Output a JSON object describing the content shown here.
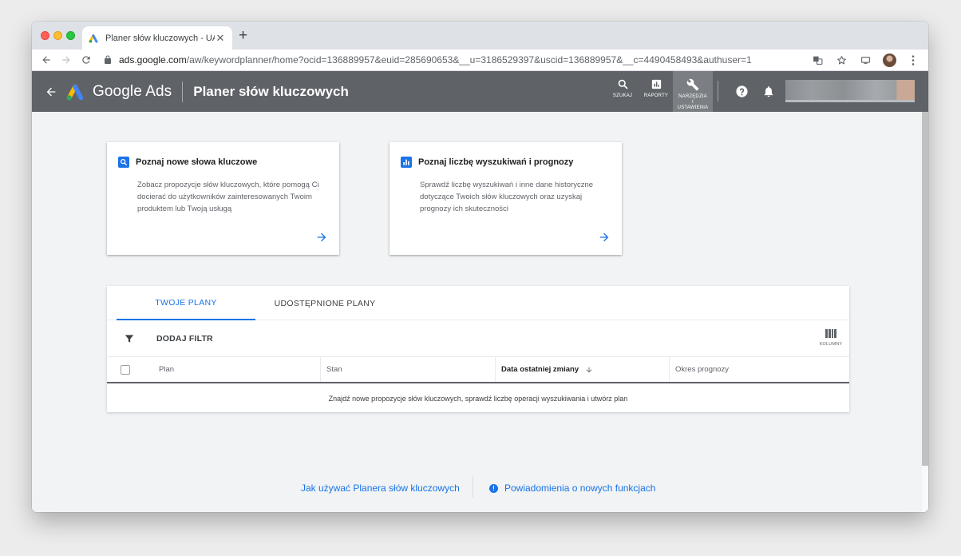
{
  "browser": {
    "tab_title": "Planer słów kluczowych - UAB \"",
    "tab_close": "✕",
    "new_tab": "+",
    "url_host": "ads.google.com",
    "url_path": "/aw/keywordplanner/home?ocid=136889957&euid=285690653&__u=3186529397&uscid=136889957&__c=4490458493&authuser=1"
  },
  "ads_header": {
    "brand": "Google Ads",
    "page_title": "Planer słów kluczowych",
    "actions": [
      {
        "label": "SZUKAJ",
        "icon": "search-icon"
      },
      {
        "label": "RAPORTY",
        "icon": "reports-icon"
      },
      {
        "label_line1": "NARZĘDZIA",
        "label_line2": "I",
        "label_line3": "USTAWIENIA",
        "icon": "wrench-icon"
      }
    ]
  },
  "cards": [
    {
      "title": "Poznaj nowe słowa kluczowe",
      "description": "Zobacz propozycje słów kluczowych, które pomogą Ci docierać do użytkowników zainteresowanych Twoim produktem lub Twoją usługą",
      "icon": "search-icon"
    },
    {
      "title": "Poznaj liczbę wyszukiwań i prognozy",
      "description": "Sprawdź liczbę wyszukiwań i inne dane historyczne dotyczące Twoich słów kluczowych oraz uzyskaj prognozy ich skuteczności",
      "icon": "bar-chart-icon"
    }
  ],
  "plans": {
    "tabs": [
      "TWOJE PLANY",
      "UDOSTĘPNIONE PLANY"
    ],
    "filter_label": "DODAJ FILTR",
    "columns_label": "KOLUMNY",
    "headers": [
      "Plan",
      "Stan",
      "Data ostatniej zmiany",
      "Okres prognozy"
    ],
    "empty_message": "Znajdź nowe propozycje słów kluczowych, sprawdź liczbę operacji wyszukiwania i utwórz plan"
  },
  "footer": {
    "help_link": "Jak używać Planera słów kluczowych",
    "news_link": "Powiadomienia o nowych funkcjach"
  },
  "colors": {
    "accent": "#1a73e8",
    "header_bg": "#5f6368",
    "page_bg": "#f1f3f4"
  }
}
